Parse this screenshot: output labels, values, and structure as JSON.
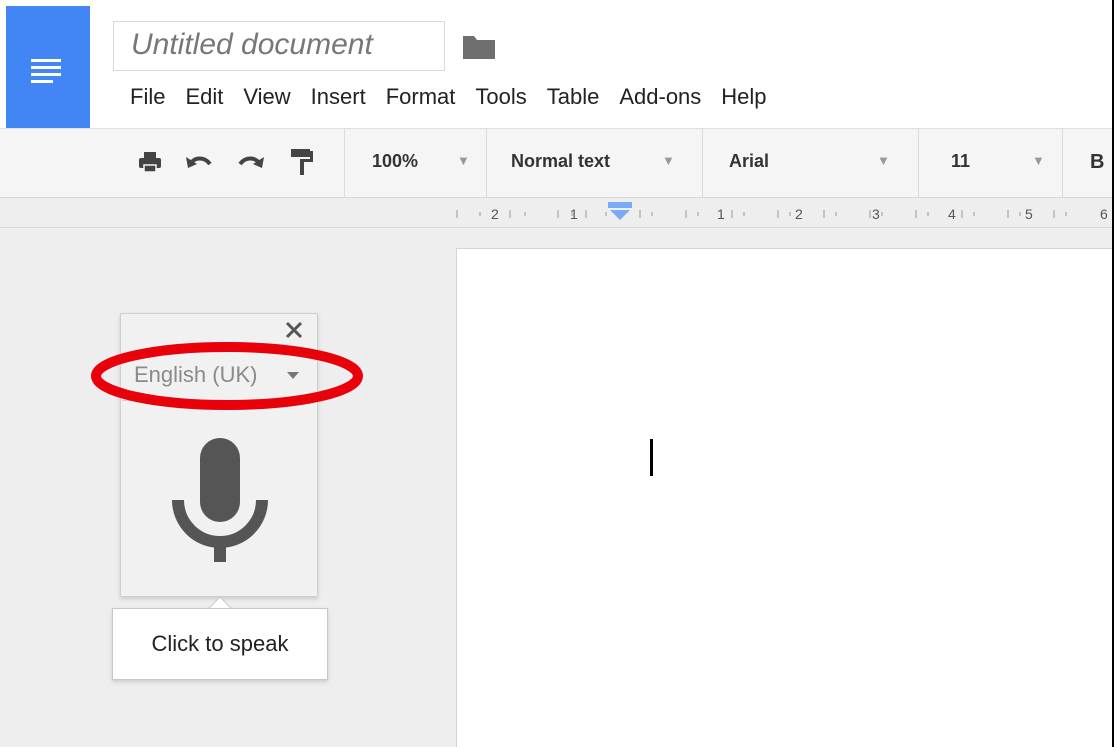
{
  "document": {
    "title": "Untitled document"
  },
  "menubar": {
    "items": [
      "File",
      "Edit",
      "View",
      "Insert",
      "Format",
      "Tools",
      "Table",
      "Add-ons",
      "Help"
    ]
  },
  "toolbar": {
    "zoom": "100%",
    "style": "Normal text",
    "font": "Arial",
    "font_size": "11",
    "bold_label": "B",
    "icons": [
      "print-icon",
      "undo-icon",
      "redo-icon",
      "paint-format-icon"
    ]
  },
  "ruler": {
    "labels": [
      "2",
      "1",
      "1",
      "2",
      "3",
      "4",
      "5",
      "6"
    ]
  },
  "voice_typing": {
    "language": "English (UK)",
    "tooltip": "Click to speak"
  },
  "colors": {
    "brand_blue": "#4285f4",
    "annotation_red": "#e8000b",
    "indent_marker": "#7baaf7"
  }
}
